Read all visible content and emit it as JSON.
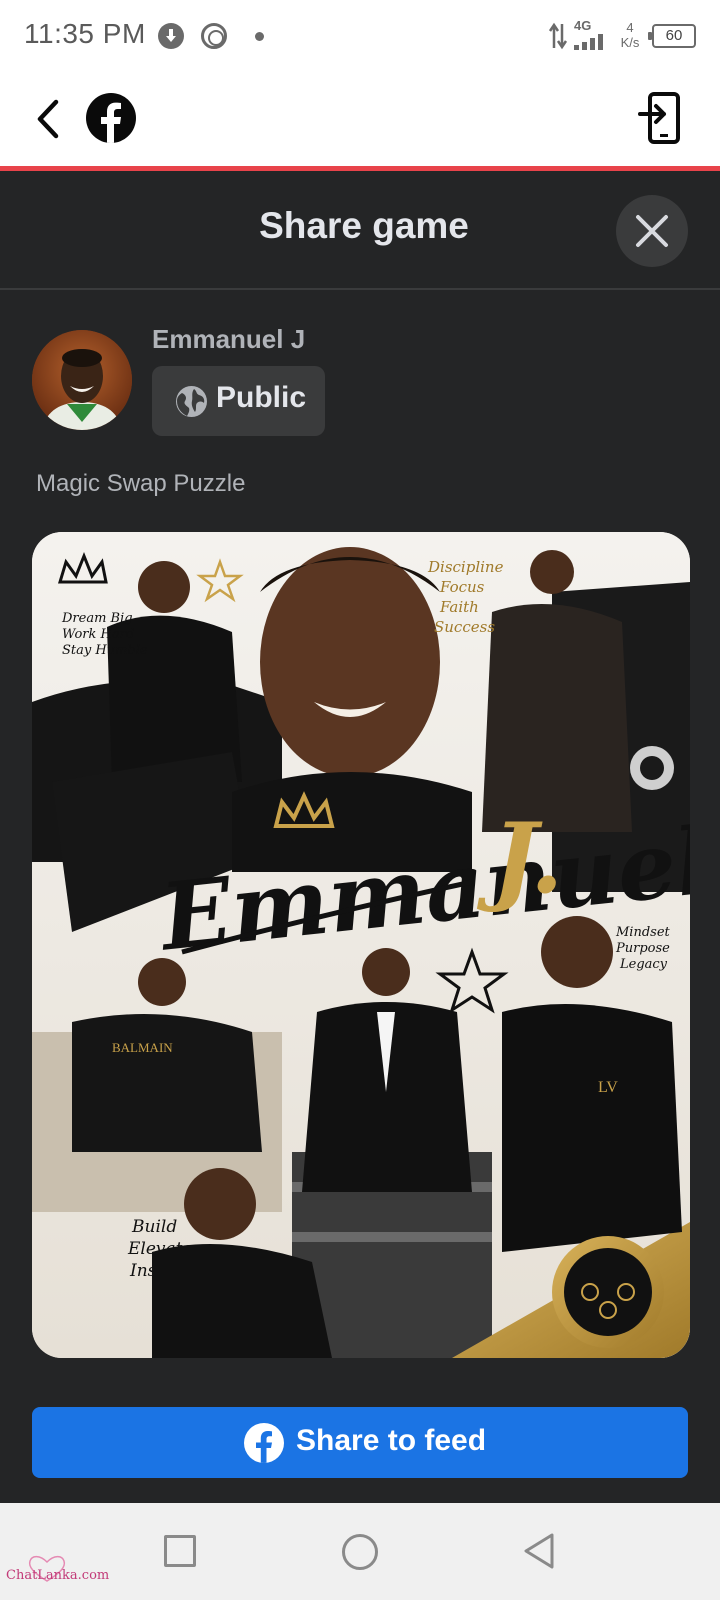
{
  "status_bar": {
    "time": "11:35 PM",
    "network": "4G",
    "speed_value": "4",
    "speed_unit": "K/s",
    "battery": "60",
    "icons": [
      "download-icon",
      "sync-ring-icon",
      "notification-dot-icon",
      "data-arrows-icon",
      "signal-icon",
      "battery-icon"
    ]
  },
  "header": {
    "back_icon": "chevron-left-icon",
    "logo_icon": "facebook-logo-icon",
    "exit_icon": "exit-app-icon",
    "accent_color": "#e8434a"
  },
  "sheet": {
    "title": "Share game",
    "close_icon": "close-icon"
  },
  "post": {
    "user_name": "Emmanuel J",
    "privacy_label": "Public",
    "privacy_icon": "globe-icon",
    "game_name": "Magic Swap Puzzle",
    "image": {
      "headline_script": "Emmanuel",
      "headline_initial": "J.",
      "quote_top_left": [
        "Dream Big",
        "Work Hard",
        "Stay Humble"
      ],
      "quote_top_right": [
        "Discipline",
        "Focus",
        "Faith",
        "Success"
      ],
      "quote_mid_right": [
        "Mindset",
        "Purpose",
        "Legacy"
      ],
      "quote_bottom_left": [
        "Build",
        "Elevate",
        "Inspire"
      ],
      "shirt_text": "BALMAIN",
      "monogram": "LV"
    }
  },
  "share": {
    "label": "Share to feed",
    "icon": "facebook-logo-icon",
    "color": "#1b74e4"
  },
  "nav_bar": {
    "icons": [
      "recents-square-icon",
      "home-circle-icon",
      "back-triangle-icon"
    ]
  },
  "watermark": {
    "text": "ChatLanka.com"
  }
}
